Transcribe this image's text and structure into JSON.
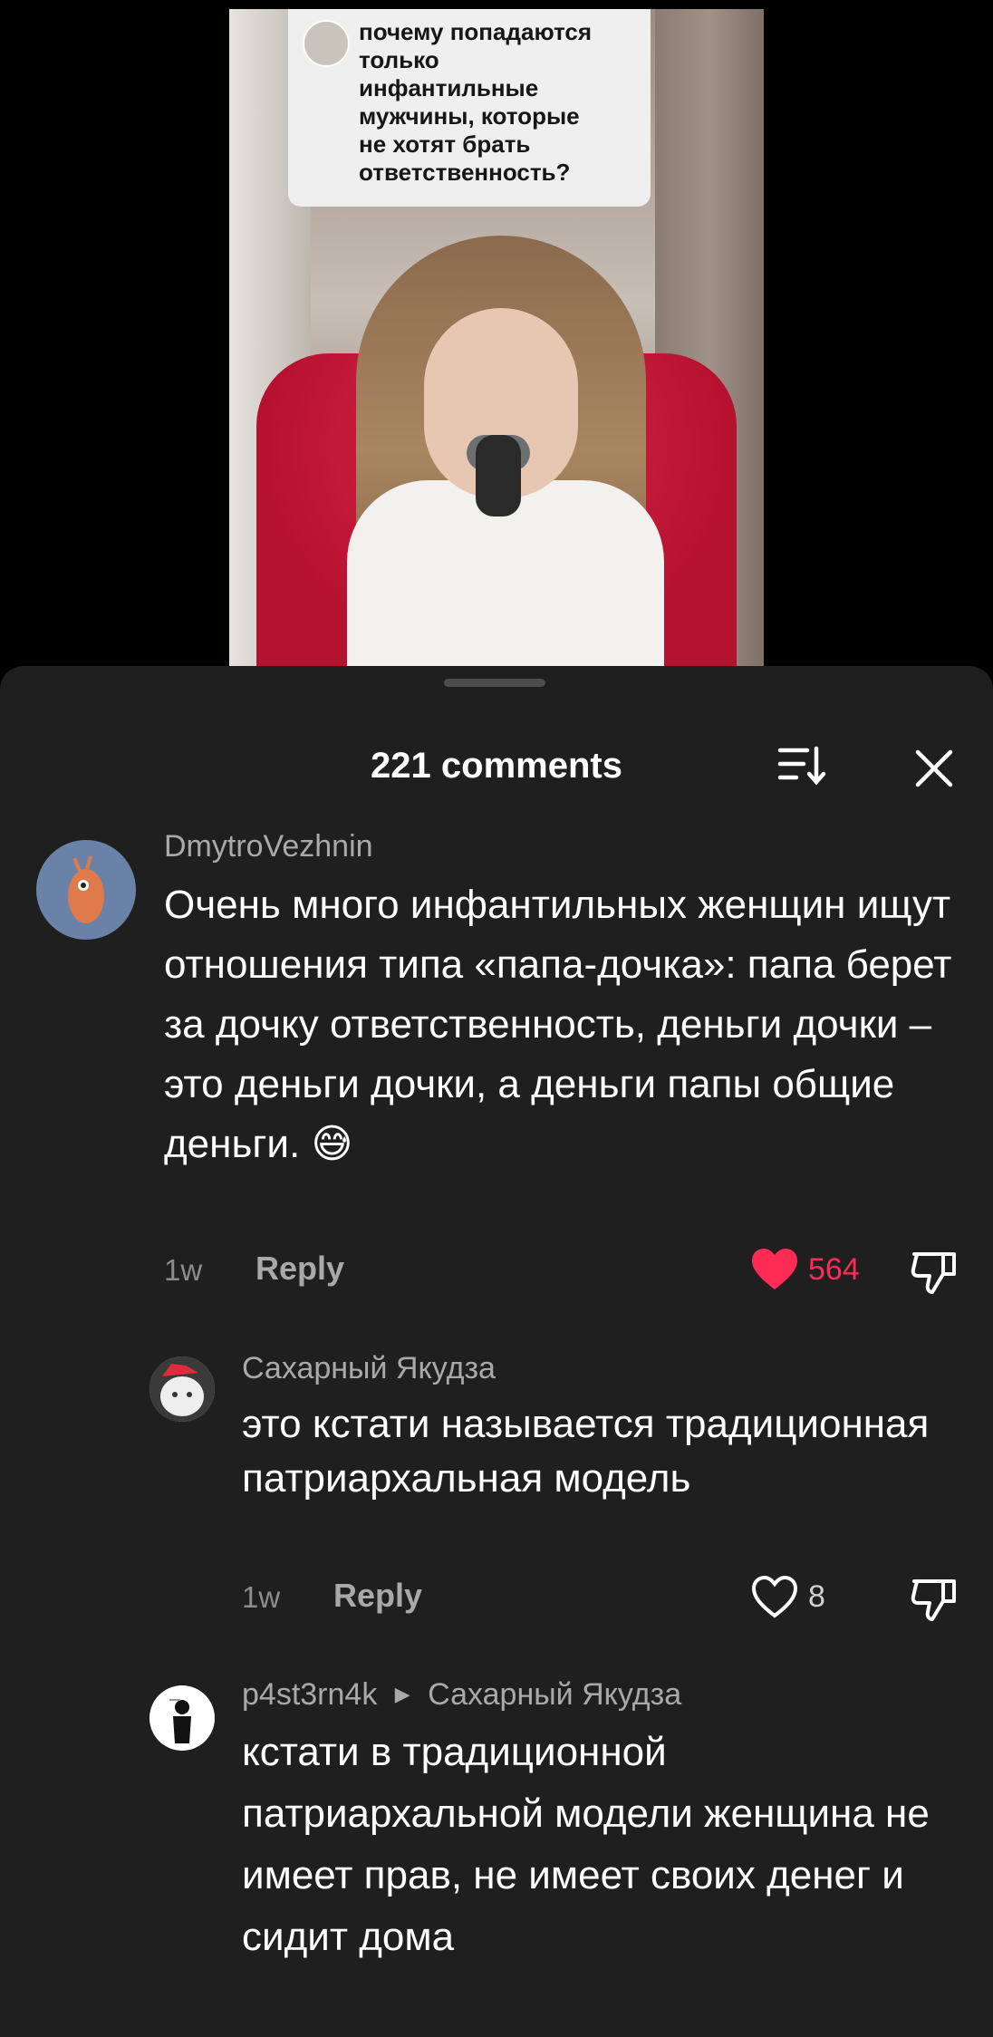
{
  "video": {
    "question_lines": "почему попадаются\nтолько\nинфантильные\nмужчины, которые\nне хотят брать\nответственность?"
  },
  "header": {
    "title": "221 comments"
  },
  "comments": [
    {
      "username": "DmytroVezhnin",
      "text": "Очень много инфантильных женщин ищут отношения типа «папа-дочка»: папа берет за дочку ответственность, деньги дочки – это деньги дочки, а деньги папы общие деньги.",
      "emoji": "😅",
      "time": "1w",
      "reply_label": "Reply",
      "likes": "564",
      "liked": true
    },
    {
      "username": "Сахарный Якудза",
      "text": "это кстати называется традиционная патриархальная модель",
      "time": "1w",
      "reply_label": "Reply",
      "likes": "8",
      "liked": false
    },
    {
      "username": "p4st3rn4k",
      "reply_to": "Сахарный Якудза",
      "text": "кстати в традиционной патриархальной модели женщина не имеет прав, не имеет своих денег и сидит дома"
    }
  ],
  "colors": {
    "like_red": "#fe2c55",
    "sheet_bg": "#1f1f1f"
  }
}
